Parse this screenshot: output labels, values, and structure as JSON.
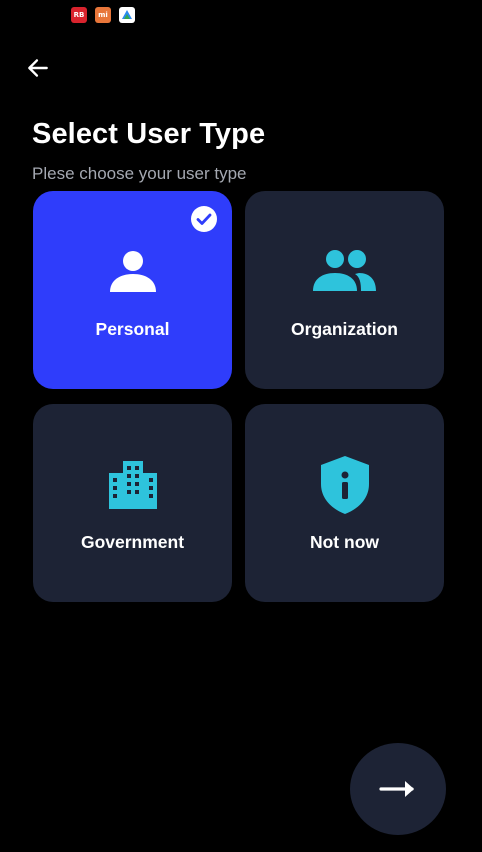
{
  "status_bar": {
    "icons": [
      {
        "name": "red-app-icon",
        "label": "RB"
      },
      {
        "name": "mi-app-icon",
        "label": "mi"
      },
      {
        "name": "drive-app-icon",
        "label": ""
      }
    ]
  },
  "header": {
    "back_icon": "arrow-left-icon",
    "title": "Select User Type",
    "subtitle": "Plese choose your user type"
  },
  "user_types": [
    {
      "label": "Personal",
      "icon": "person-icon",
      "selected": true
    },
    {
      "label": "Organization",
      "icon": "group-icon",
      "selected": false
    },
    {
      "label": "Government",
      "icon": "building-icon",
      "selected": false
    },
    {
      "label": "Not now",
      "icon": "shield-info-icon",
      "selected": false
    }
  ],
  "next_button": {
    "icon": "arrow-right-icon"
  },
  "colors": {
    "background": "#000000",
    "card": "#1d2335",
    "card_selected": "#2f3dfb",
    "icon_accent": "#2ec3dc",
    "subtitle": "#a4a8b1"
  }
}
